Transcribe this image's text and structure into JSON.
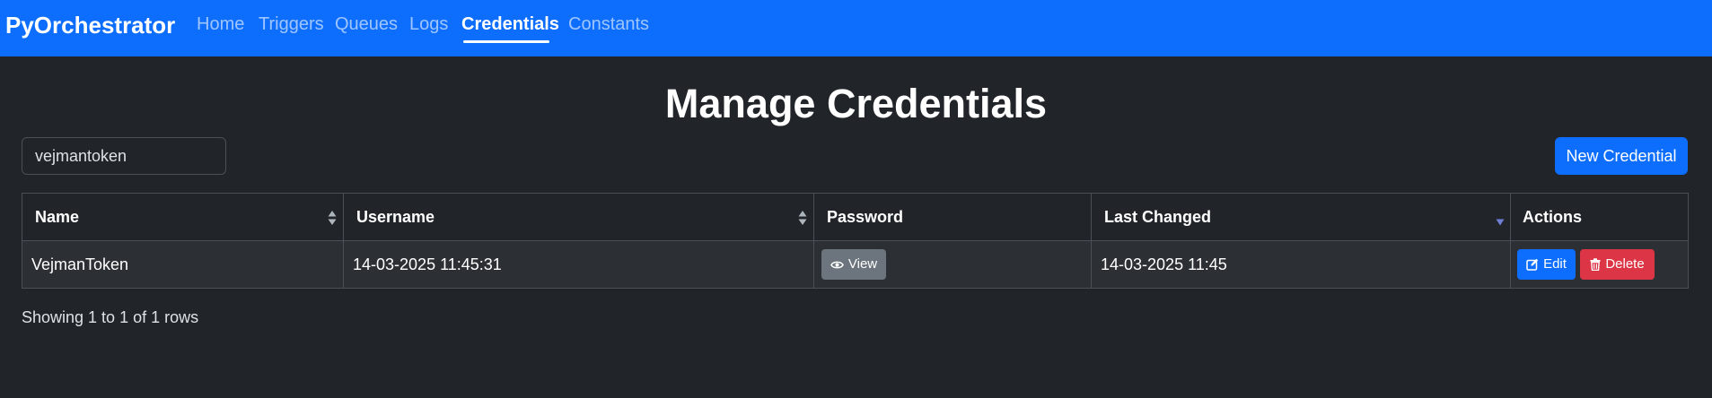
{
  "navbar": {
    "brand": "PyOrchestrator",
    "links": [
      {
        "label": "Home"
      },
      {
        "label": "Triggers"
      },
      {
        "label": "Queues"
      },
      {
        "label": "Logs"
      },
      {
        "label": "Credentials"
      },
      {
        "label": "Constants"
      }
    ],
    "active": "Credentials"
  },
  "page": {
    "title": "Manage Credentials"
  },
  "search": {
    "value": "vejmantoken"
  },
  "toolbar": {
    "new_label": "New Credential"
  },
  "table": {
    "columns": [
      {
        "label": "Name",
        "sort": "both"
      },
      {
        "label": "Username",
        "sort": "both"
      },
      {
        "label": "Password",
        "sort": "none"
      },
      {
        "label": "Last Changed",
        "sort": "desc"
      },
      {
        "label": "Actions",
        "sort": "none"
      }
    ],
    "rows": [
      {
        "name": "VejmanToken",
        "username": "14-03-2025 11:45:31",
        "password_button": "View",
        "last_changed": "14-03-2025 11:45",
        "edit_label": "Edit",
        "delete_label": "Delete"
      }
    ],
    "footer": "Showing 1 to 1 of 1 rows"
  },
  "icons": {
    "view": "eye-icon",
    "edit": "pencil-square-icon",
    "delete": "trash-icon",
    "sort": "sort-arrows-icon"
  },
  "colors": {
    "primary": "#0d6efd",
    "secondary": "#6c757d",
    "danger": "#dc3545",
    "background": "#212529"
  }
}
